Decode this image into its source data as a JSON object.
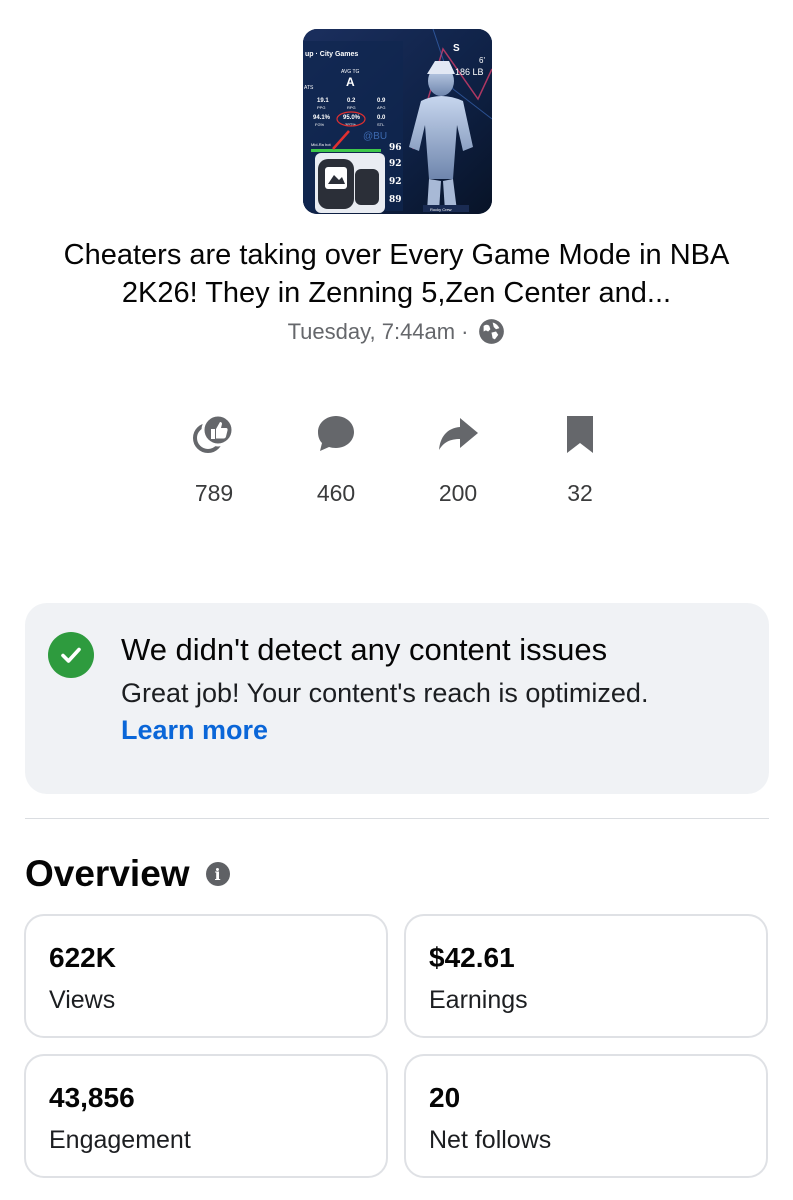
{
  "thumbnail": {
    "hud_top": "up · City Games",
    "avg_label": "AVG TG",
    "grade": "A",
    "stats_tag": "ATS",
    "stats_row1": [
      "19.1",
      "0.2",
      "0.9"
    ],
    "stats_row1_labels": [
      "PPG",
      "RPG",
      "APG"
    ],
    "stats_row2": [
      "94.1%",
      "95.0%",
      "0.0"
    ],
    "stats_row2_labels": [
      "FG%",
      "3PT%",
      "STL"
    ],
    "midrange_label": "Mid-Ra   hot",
    "ratings": [
      "96",
      "92",
      "92",
      "89"
    ],
    "height_text": "6'",
    "weight_text": "186 LB",
    "corner_letter": "S",
    "watermark": "@BU",
    "name_tag": "Rocky Crew"
  },
  "post": {
    "title": "Cheaters are taking over Every Game Mode in NBA 2K26! They in Zenning 5,Zen Center and...",
    "time": "Tuesday, 7:44am",
    "separator": "·",
    "visibility_icon": "globe-icon"
  },
  "actions": [
    {
      "icon": "like-reactions-icon",
      "count": "789"
    },
    {
      "icon": "comment-icon",
      "count": "460"
    },
    {
      "icon": "share-icon",
      "count": "200"
    },
    {
      "icon": "bookmark-icon",
      "count": "32"
    }
  ],
  "notice": {
    "title": "We didn't detect any content issues",
    "body": "Great job! Your content's reach is optimized.",
    "link": "Learn more",
    "status_color": "#2e9b3e",
    "link_color": "#0a66d8"
  },
  "overview": {
    "title": "Overview",
    "metrics": [
      {
        "value": "622K",
        "label": "Views"
      },
      {
        "value": "$42.61",
        "label": "Earnings"
      },
      {
        "value": "43,856",
        "label": "Engagement"
      },
      {
        "value": "20",
        "label": "Net follows"
      }
    ]
  }
}
